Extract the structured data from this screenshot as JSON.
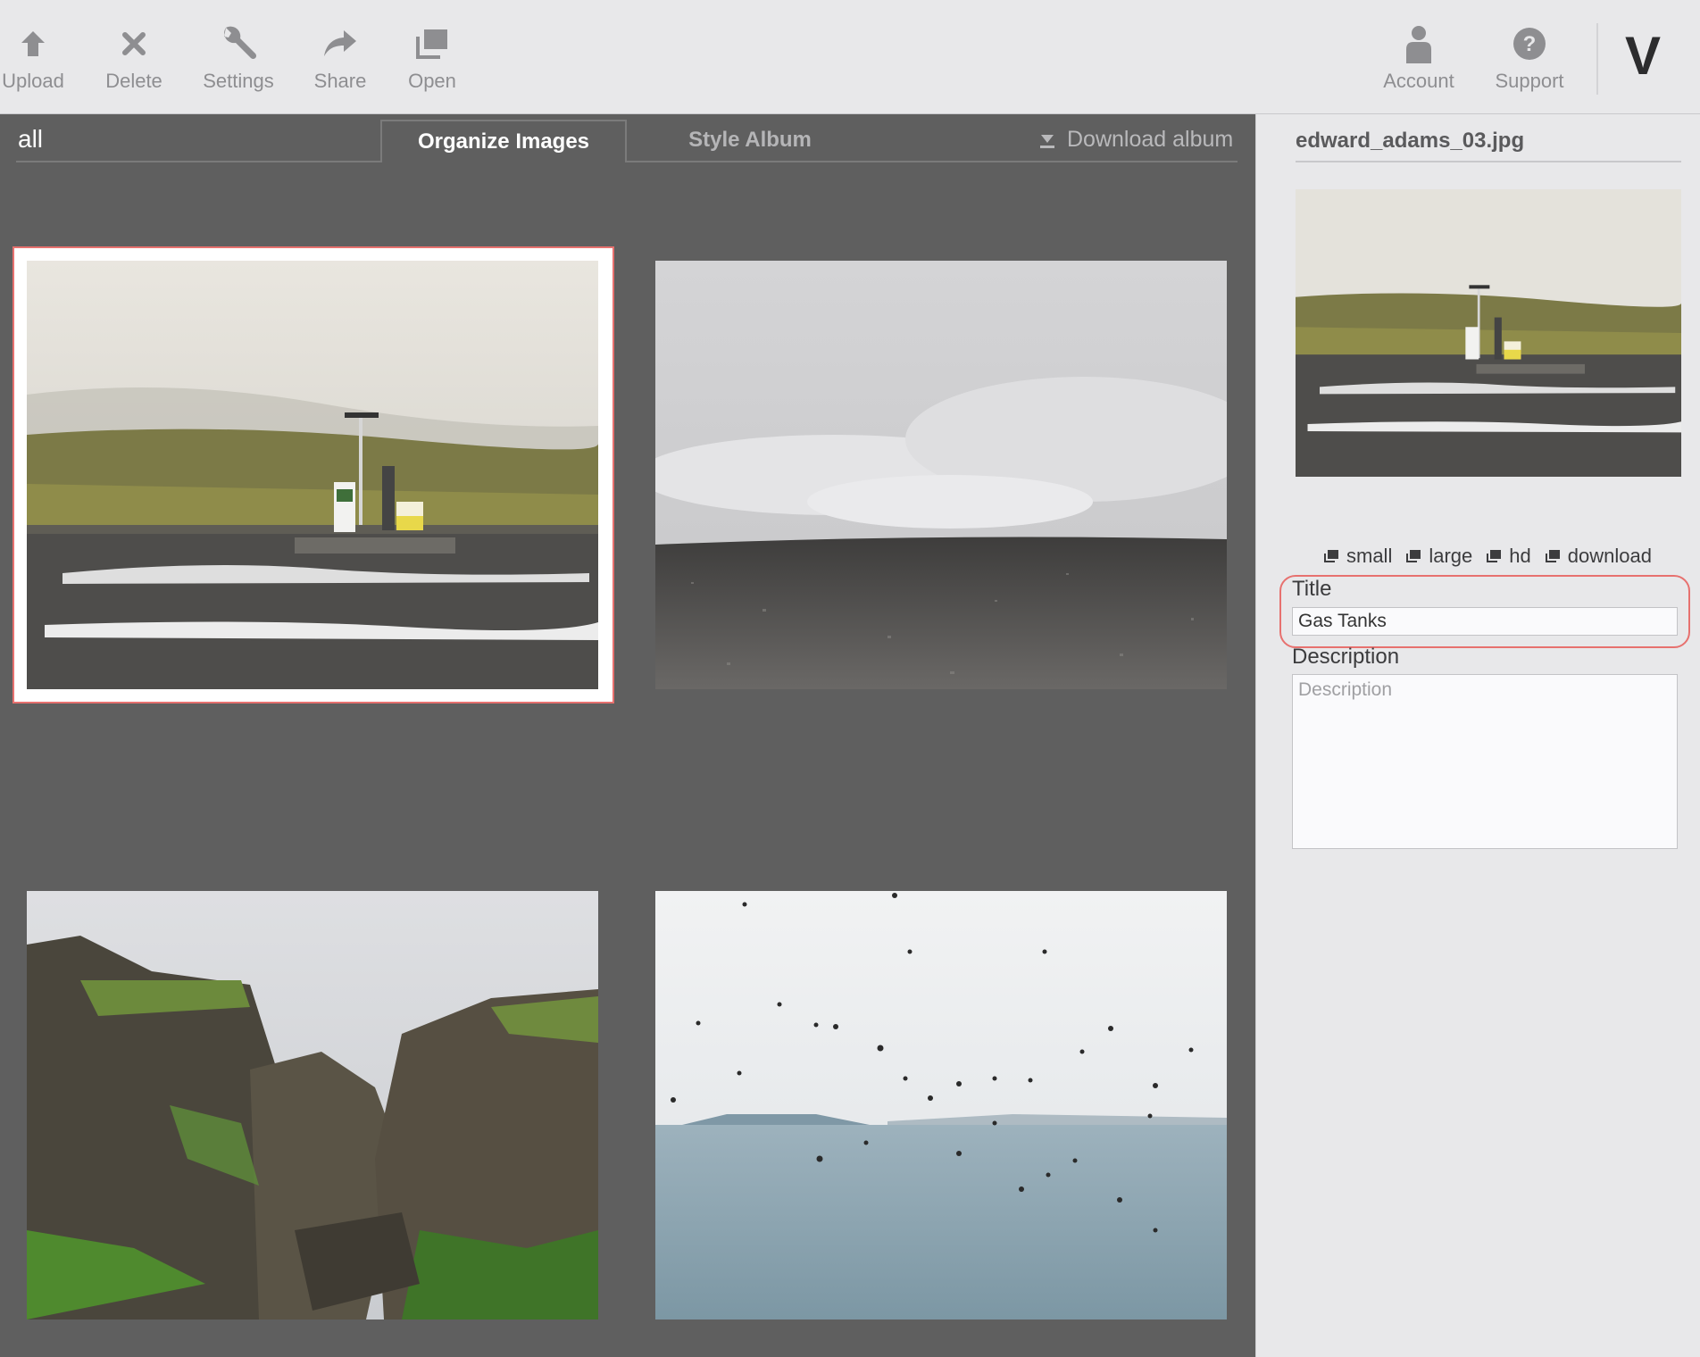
{
  "toolbar": {
    "upload": "Upload",
    "delete": "Delete",
    "settings": "Settings",
    "share": "Share",
    "open": "Open",
    "account": "Account",
    "support": "Support",
    "brand": "V"
  },
  "album": {
    "name": "all",
    "tabs": {
      "organize": "Organize Images",
      "style": "Style Album",
      "active": "Organize Images"
    },
    "download": "Download album"
  },
  "grid": {
    "images": [
      {
        "subject": "gas-station-landscape",
        "selected": true
      },
      {
        "subject": "cloudy-gravel-plain",
        "selected": false
      },
      {
        "subject": "mossy-cliffs-canyon",
        "selected": false
      },
      {
        "subject": "birds-over-sea",
        "selected": false
      }
    ]
  },
  "inspector": {
    "filename": "edward_adams_03.jpg",
    "sizes": [
      "small",
      "large",
      "hd",
      "download"
    ],
    "title_label": "Title",
    "title_value": "Gas Tanks",
    "description_label": "Description",
    "description_placeholder": "Description",
    "description_value": ""
  },
  "colors": {
    "accent": "#e7716f",
    "toolbar_bg": "#e8e8ea",
    "main_bg": "#5f5f5f"
  }
}
